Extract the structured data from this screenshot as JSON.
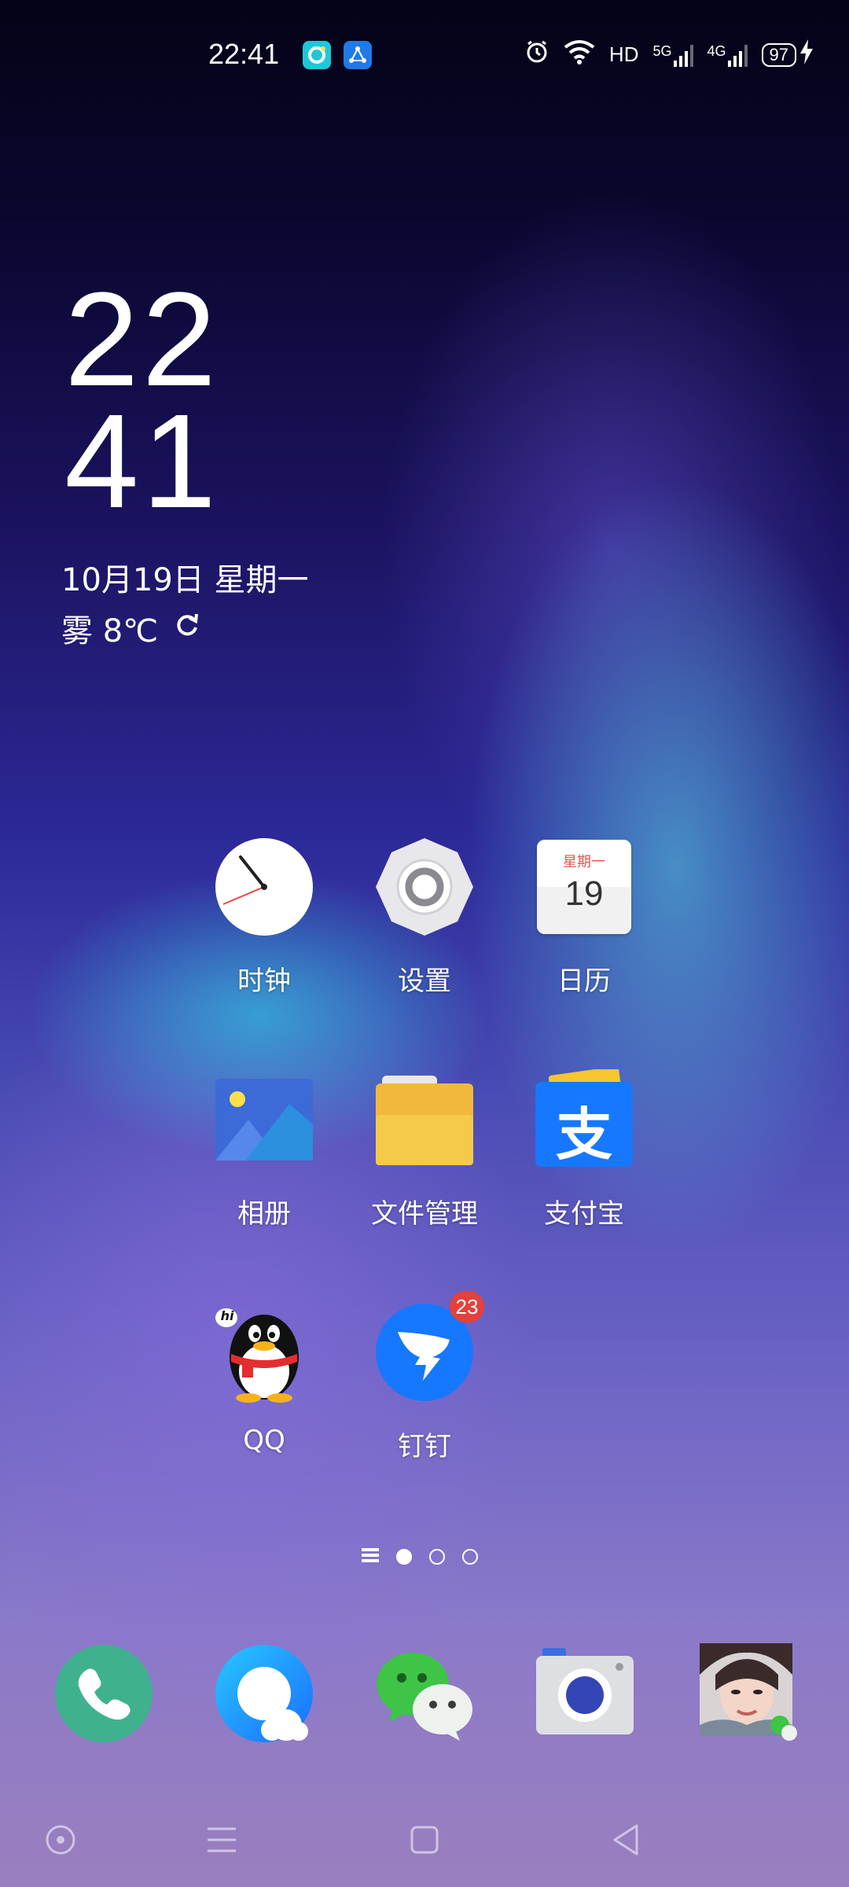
{
  "status_bar": {
    "time": "22:41",
    "network_label": "HD",
    "sim1_tech": "5G",
    "sim2_tech": "4G",
    "battery_level": "97",
    "icons": [
      "pinwheel-app-icon",
      "share-app-icon",
      "alarm-icon",
      "wifi-icon",
      "hd-icon",
      "signal-5g-icon",
      "signal-4g-icon",
      "battery-icon",
      "charging-icon"
    ]
  },
  "clock_widget": {
    "hours": "22",
    "minutes": "41",
    "date": "10月19日 星期一",
    "weather": "雾 8℃"
  },
  "apps": [
    {
      "label": "时钟"
    },
    {
      "label": "设置"
    },
    {
      "label": "日历",
      "weekday": "星期一",
      "day": "19"
    },
    {
      "label": "相册"
    },
    {
      "label": "文件管理"
    },
    {
      "label": "支付宝",
      "glyph": "支"
    },
    {
      "label": "QQ",
      "bubble": "hi"
    },
    {
      "label": "钉钉",
      "badge": "23"
    }
  ],
  "pager": {
    "pages": 3,
    "active": 0
  },
  "dock": [
    "phone-icon",
    "browser-icon",
    "wechat-icon",
    "camera-icon",
    "contact-photo-icon"
  ],
  "colors": {
    "phone": "#3fb18f",
    "dingtalk": "#1677ff",
    "alipay": "#1678ff",
    "badge": "#e5403b",
    "calendar_accent": "#e2574c"
  }
}
